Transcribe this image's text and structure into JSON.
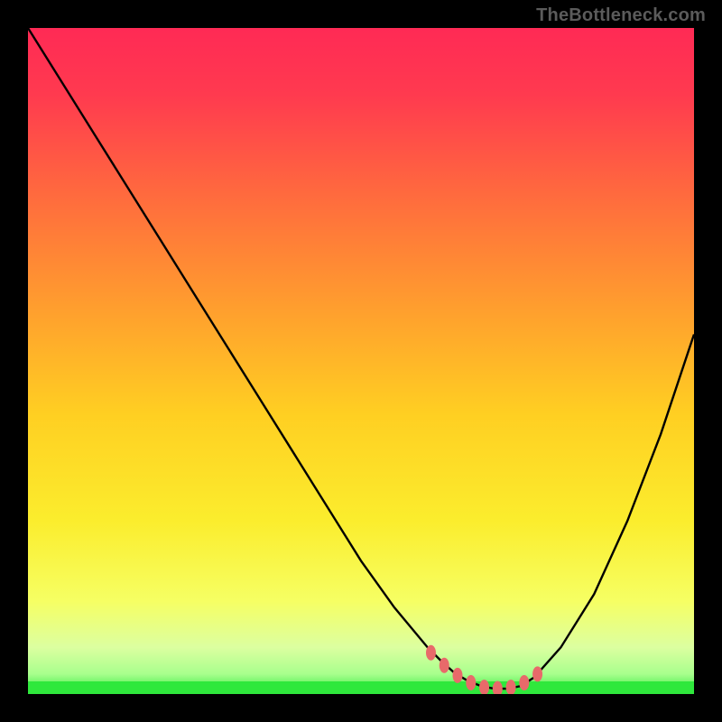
{
  "attribution": "TheBottleneck.com",
  "colors": {
    "gradient_top": "#ff2a55",
    "gradient_mid": "#ffd820",
    "gradient_low": "#fcff7a",
    "gradient_bottom": "#2fe83c",
    "curve": "#000000",
    "marker": "#e86a6a",
    "frame_bg": "#000000"
  },
  "chart_data": {
    "type": "line",
    "title": "",
    "xlabel": "",
    "ylabel": "",
    "xlim": [
      0,
      100
    ],
    "ylim": [
      0,
      100
    ],
    "grid": false,
    "legend": false,
    "x": [
      0,
      5,
      10,
      15,
      20,
      25,
      30,
      35,
      40,
      45,
      50,
      55,
      60,
      62,
      64,
      66,
      68,
      70,
      72,
      74,
      76,
      80,
      85,
      90,
      95,
      100
    ],
    "values": [
      100,
      92,
      84,
      76,
      68,
      60,
      52,
      44,
      36,
      28,
      20,
      13,
      7,
      5,
      3.2,
      2,
      1.2,
      0.8,
      0.8,
      1.2,
      2.5,
      7,
      15,
      26,
      39,
      54
    ],
    "series": [
      {
        "name": "bottleneck_curve",
        "x": [
          0,
          5,
          10,
          15,
          20,
          25,
          30,
          35,
          40,
          45,
          50,
          55,
          60,
          62,
          64,
          66,
          68,
          70,
          72,
          74,
          76,
          80,
          85,
          90,
          95,
          100
        ],
        "values": [
          100,
          92,
          84,
          76,
          68,
          60,
          52,
          44,
          36,
          28,
          20,
          13,
          7,
          5,
          3.2,
          2,
          1.2,
          0.8,
          0.8,
          1.2,
          2.5,
          7,
          15,
          26,
          39,
          54
        ]
      }
    ],
    "markers": [
      {
        "x": 60.5,
        "y": 6.2
      },
      {
        "x": 62.5,
        "y": 4.3
      },
      {
        "x": 64.5,
        "y": 2.8
      },
      {
        "x": 66.5,
        "y": 1.7
      },
      {
        "x": 68.5,
        "y": 1.0
      },
      {
        "x": 70.5,
        "y": 0.8
      },
      {
        "x": 72.5,
        "y": 1.0
      },
      {
        "x": 74.5,
        "y": 1.7
      },
      {
        "x": 76.5,
        "y": 3.0
      }
    ]
  }
}
